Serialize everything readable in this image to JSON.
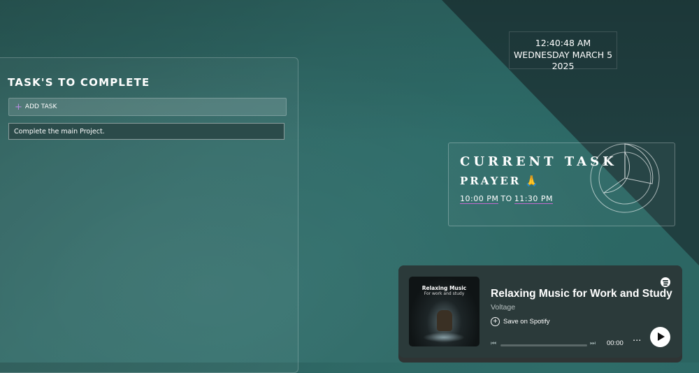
{
  "tasks": {
    "title": "TASK'S TO COMPLETE",
    "add_label": "ADD TASK",
    "items": [
      {
        "text": "Complete the main Project."
      }
    ]
  },
  "clock": {
    "time": "12:40:48 AM",
    "date": "WEDNESDAY MARCH 5",
    "year": "2025"
  },
  "current_task": {
    "title": "CURRENT TASK",
    "name": "PRAYER",
    "emoji": "🙏",
    "start": "10:00 PM",
    "separator": "TO",
    "end": "11:30 PM"
  },
  "spotify": {
    "album_title": "Relaxing Music",
    "album_subtitle": "For work and study",
    "title": "Relaxing Music for Work and Study",
    "artist": "Voltage",
    "save_label": "Save on Spotify",
    "time": "00:00",
    "more": "···"
  },
  "colors": {
    "accent_purple": "#b58be0",
    "underline": "#c56ad0",
    "panel_bg": "#2b3a3a"
  }
}
